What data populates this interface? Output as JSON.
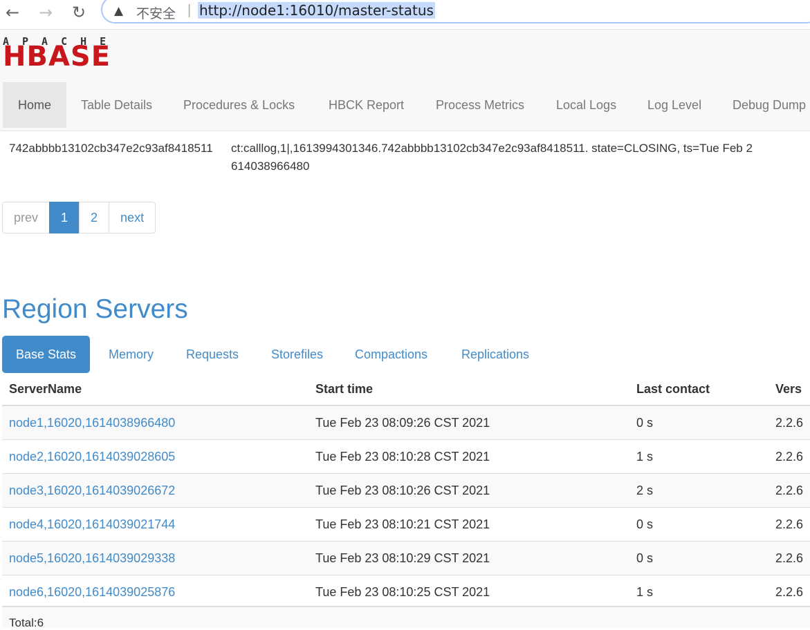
{
  "browser": {
    "back_icon": "←",
    "forward_icon": "→",
    "reload_icon": "↻",
    "warning_icon": "▲",
    "insecure_label": "不安全",
    "url": "http://node1:16010/master-status"
  },
  "logo": {
    "top_text": "APACHE",
    "main_text": "HBASE",
    "brand_color": "#c8161d"
  },
  "nav": {
    "items": [
      "Home",
      "Table Details",
      "Procedures & Locks",
      "HBCK Report",
      "Process Metrics",
      "Local Logs",
      "Log Level",
      "Debug Dump"
    ],
    "active": "Home"
  },
  "region_in_transition": {
    "region_id": "742abbbb13102cb347e2c93af8418511",
    "state": "ct:calllog,1|,1613994301346.742abbbb13102cb347e2c93af8418511. state=CLOSING, ts=Tue Feb 2 614038966480"
  },
  "pagination": {
    "prev": "prev",
    "pages": [
      "1",
      "2"
    ],
    "next": "next",
    "active": "1"
  },
  "region_servers": {
    "title": "Region Servers",
    "tabs": [
      "Base Stats",
      "Memory",
      "Requests",
      "Storefiles",
      "Compactions",
      "Replications"
    ],
    "active_tab": "Base Stats",
    "columns": [
      "ServerName",
      "Start time",
      "Last contact",
      "Vers"
    ],
    "rows": [
      [
        "node1,16020,1614038966480",
        "Tue Feb 23 08:09:26 CST 2021",
        "0 s",
        "2.2.6"
      ],
      [
        "node2,16020,1614039028605",
        "Tue Feb 23 08:10:28 CST 2021",
        "1 s",
        "2.2.6"
      ],
      [
        "node3,16020,1614039026672",
        "Tue Feb 23 08:10:26 CST 2021",
        "2 s",
        "2.2.6"
      ],
      [
        "node4,16020,1614039021744",
        "Tue Feb 23 08:10:21 CST 2021",
        "0 s",
        "2.2.6"
      ],
      [
        "node5,16020,1614039029338",
        "Tue Feb 23 08:10:29 CST 2021",
        "0 s",
        "2.2.6"
      ],
      [
        "node6,16020,1614039025876",
        "Tue Feb 23 08:10:25 CST 2021",
        "1 s",
        "2.2.6"
      ]
    ],
    "total": "Total:6"
  }
}
